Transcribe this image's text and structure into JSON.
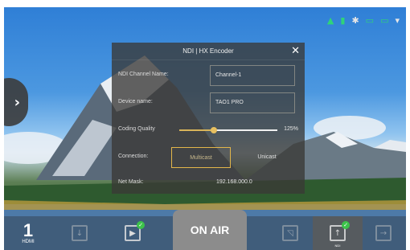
{
  "status_icons": [
    {
      "icon": "android-icon",
      "glyph": "▲",
      "color": "#2fd37a"
    },
    {
      "icon": "sd-card-icon",
      "glyph": "▮",
      "color": "#2fd37a"
    },
    {
      "icon": "bluetooth-icon",
      "glyph": "✱",
      "color": "#e6e6e6"
    },
    {
      "icon": "storage-icon",
      "glyph": "▭",
      "color": "#2fd37a"
    },
    {
      "icon": "battery-icon",
      "glyph": "▭",
      "color": "#2fd37a"
    },
    {
      "icon": "wifi-icon",
      "glyph": "▾",
      "color": "#e6e6e6"
    }
  ],
  "side_tab": {
    "icon": "chevron-right-icon",
    "glyph": "›"
  },
  "panel": {
    "title": "NDI | HX Encoder",
    "close_glyph": "✕",
    "channel_name_label": "NDI Channel Name:",
    "channel_name_value": "Channel-1",
    "device_name_label": "Device name:",
    "device_name_value": "TAO1 PRO",
    "coding_quality_label": "Coding Quality",
    "coding_quality_percent": "125%",
    "coding_quality_level": 0.35,
    "connection_label": "Connection:",
    "connection_options": [
      "Multicast",
      "Unicast"
    ],
    "connection_selected": "Multicast",
    "net_mask_label": "Net Mask:",
    "net_mask_value": "192.168.000.0"
  },
  "bottom_bar": {
    "hdmi_number": "1",
    "hdmi_label": "HDMI",
    "on_air_label": "ON AIR",
    "ndi_label": "NDI",
    "badge_glyph": "✓"
  }
}
